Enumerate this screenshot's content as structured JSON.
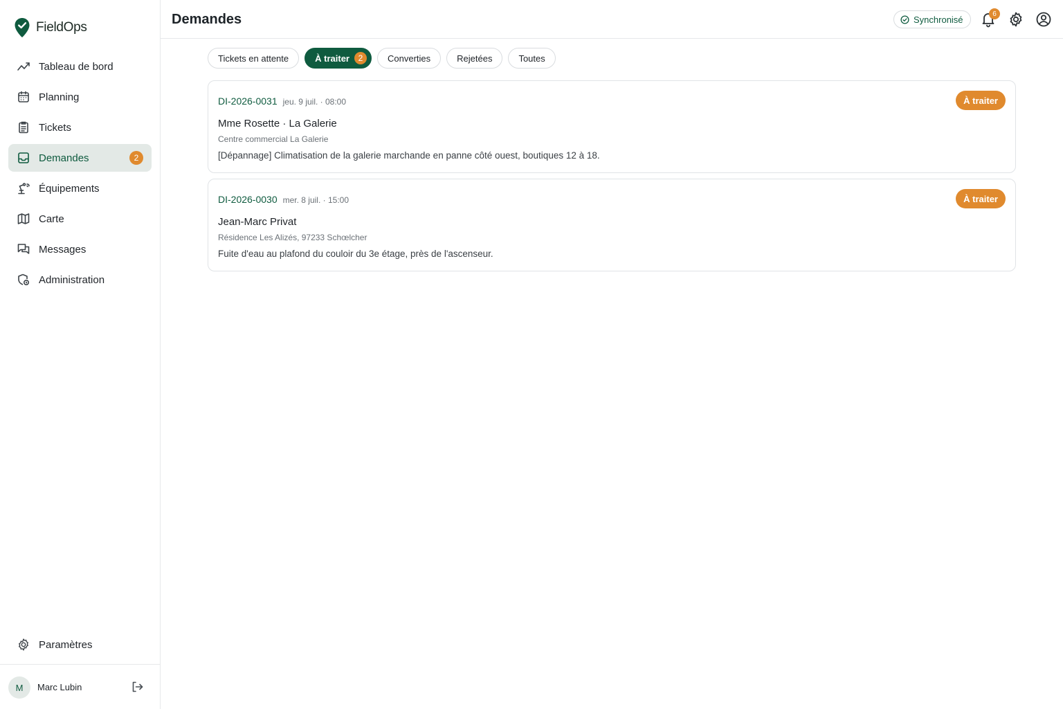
{
  "app": {
    "name": "FieldOps"
  },
  "sidebar": {
    "items": [
      {
        "label": "Tableau de bord",
        "icon": "chart-line-icon"
      },
      {
        "label": "Planning",
        "icon": "calendar-icon"
      },
      {
        "label": "Tickets",
        "icon": "clipboard-icon"
      },
      {
        "label": "Demandes",
        "icon": "inbox-icon",
        "badge": "2",
        "active": true
      },
      {
        "label": "Équipements",
        "icon": "equipment-icon"
      },
      {
        "label": "Carte",
        "icon": "map-icon"
      },
      {
        "label": "Messages",
        "icon": "messages-icon"
      },
      {
        "label": "Administration",
        "icon": "admin-shield-icon"
      }
    ],
    "settings_label": "Paramètres",
    "user": {
      "initial": "M",
      "name": "Marc Lubin"
    }
  },
  "header": {
    "title": "Demandes",
    "sync_label": "Synchronisé",
    "notifications_count": "6"
  },
  "tabs": [
    {
      "label": "Tickets en attente"
    },
    {
      "label": "À traiter",
      "count": "2",
      "active": true
    },
    {
      "label": "Converties"
    },
    {
      "label": "Rejetées"
    },
    {
      "label": "Toutes"
    }
  ],
  "requests": [
    {
      "ref": "DI-2026-0031",
      "date": "jeu. 9 juil. · 08:00",
      "status": "À traiter",
      "client": "Mme Rosette · La Galerie",
      "site": "Centre commercial La Galerie",
      "description": "[Dépannage] Climatisation de la galerie marchande en panne côté ouest, boutiques 12 à 18."
    },
    {
      "ref": "DI-2026-0030",
      "date": "mer. 8 juil. · 15:00",
      "status": "À traiter",
      "client": "Jean-Marc Privat",
      "site": "Résidence Les Alizés, 97233 Schœlcher",
      "description": "Fuite d'eau au plafond du couloir du 3e étage, près de l'ascenseur."
    }
  ],
  "colors": {
    "brand": "#0f5b3f",
    "accent": "#e08a2e",
    "active_bg": "#e3e9e6"
  }
}
